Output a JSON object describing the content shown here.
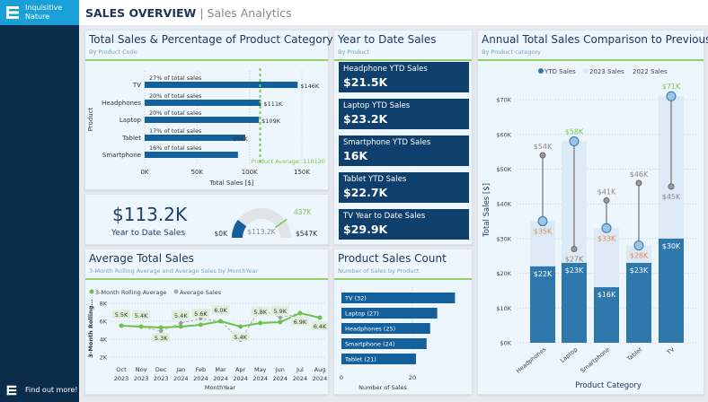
{
  "sidebar": {
    "brand_line1": "Inquisitive",
    "brand_line2": "Nature",
    "find_out_more": "Find out more!"
  },
  "header": {
    "title": "SALES OVERVIEW",
    "separator": "|",
    "subtitle": "Sales Analytics"
  },
  "colors": {
    "navy": "#0b2d4b",
    "brand": "#1aa0d9",
    "bar": "#13609d",
    "accent_green": "#8fd16d",
    "ytd": "#2e78ad",
    "sales2023": "#dde9f5",
    "label_orange": "#e08a5a"
  },
  "panels": {
    "total_sales": {
      "title": "Total Sales & Percentage of Product Category",
      "subtitle": "By Product Code"
    },
    "ytd": {
      "title": "Year to Date Sales",
      "subtitle": "By Product"
    },
    "annual": {
      "title": "Annual Total Sales Comparison to Previous",
      "subtitle": "By Product category"
    },
    "avg": {
      "title": "Average Total Sales",
      "subtitle": "3-Month Rolling Average and Average Sales by MonthYear"
    },
    "count": {
      "title": "Product Sales Count",
      "subtitle": "Number of Sales by Product"
    }
  },
  "kpi": {
    "value": "$113.2K",
    "label": "Year to Date Sales",
    "gauge": {
      "min_label": "$0K",
      "max_label": "$547K",
      "value_label": "$113.2K",
      "target_label": "437K",
      "value": 113.2,
      "min": 0,
      "max": 547,
      "target": 437
    }
  },
  "ytd_cards": [
    {
      "label": "Headphone YTD Sales",
      "value": "$21.5K"
    },
    {
      "label": "Laptop YTD Sales",
      "value": "$23.2K"
    },
    {
      "label": "Smartphone YTD Sales",
      "value": "16K"
    },
    {
      "label": "Tablet YTD Sales",
      "value": "$22.7K"
    },
    {
      "label": "TV Year to Date Sales",
      "value": "$29.9K"
    }
  ],
  "chart_data": [
    {
      "type": "bar",
      "orientation": "horizontal",
      "categories": [
        "TV",
        "Headphones",
        "Laptop",
        "Tablet",
        "Smartphone"
      ],
      "values": [
        146,
        111,
        109,
        96,
        89
      ],
      "value_labels": [
        "$146K",
        "$111K",
        "$109K",
        "$96K",
        ""
      ],
      "percent_labels": [
        "27% of total sales",
        "20% of total sales",
        "20% of total sales",
        "17% of total sales",
        "16% of total sales"
      ],
      "xlabel": "Total Sales [$]",
      "ylabel": "Product",
      "xticks": [
        "0K",
        "50K",
        "100K",
        "150K"
      ],
      "xlim": [
        0,
        150
      ],
      "reference_line": {
        "value": 110.12,
        "label": "Product Average: 110120"
      }
    },
    {
      "type": "line",
      "categories": [
        "Oct 2023",
        "Nov 2023",
        "Dec 2023",
        "Jan 2024",
        "Feb 2024",
        "Mar 2024",
        "Apr 2024",
        "May 2024",
        "Jun 2024",
        "Jul 2024",
        "Aug 2024"
      ],
      "series": [
        {
          "name": "3-Month Rolling Average",
          "values": [
            5.5,
            5.4,
            5.3,
            5.4,
            5.6,
            6.0,
            5.4,
            5.8,
            5.9,
            6.9,
            6.4
          ],
          "labels": [
            "5.5K",
            "5.4K",
            "5.3K",
            "5.4K",
            "5.6K",
            "6.0K",
            "5.4K",
            "5.8K",
            "5.9K",
            "6.9K",
            "6.4K"
          ]
        },
        {
          "name": "Average Sales",
          "values": [
            5.5,
            5.4,
            4.9,
            5.8,
            6.3,
            6.0,
            3.9,
            7.4,
            6.4,
            6.9,
            6.4
          ]
        }
      ],
      "xlabel": "MonthYear",
      "ylabel": "3-Month Rolling...",
      "yticks": [
        "2K",
        "4K",
        "6K",
        "8K"
      ],
      "ylim": [
        2,
        8
      ]
    },
    {
      "type": "bar",
      "orientation": "horizontal",
      "categories": [
        "TV (32)",
        "Laptop (27)",
        "Headphones (25)",
        "Smartphone (24)",
        "Tablet (21)"
      ],
      "values": [
        32,
        27,
        25,
        24,
        21
      ],
      "xlabel": "Number of Sales",
      "xticks": [
        "0",
        "20"
      ]
    },
    {
      "type": "bar",
      "categories": [
        "Headphones",
        "Laptop",
        "Smartphone",
        "Tablet",
        "TV"
      ],
      "series": [
        {
          "name": "YTD Sales",
          "values": [
            22,
            23,
            16,
            23,
            30
          ],
          "labels": [
            "$22K",
            "$23K",
            "$16K",
            "$23K",
            "$30K"
          ]
        },
        {
          "name": "2023 Sales",
          "values": [
            35,
            58,
            33,
            28,
            71
          ],
          "labels": [
            "$35K",
            "$58K",
            "$33K",
            "$28K",
            "$71K"
          ]
        },
        {
          "name": "2022 Sales",
          "values": [
            54,
            27,
            41,
            46,
            45
          ],
          "labels": [
            "$54K",
            "$27K",
            "$41K",
            "$46K",
            "$45K"
          ]
        }
      ],
      "xlabel": "Product Category",
      "ylabel": "Total Sales [$]",
      "yticks": [
        "$0K",
        "$10K",
        "$20K",
        "$30K",
        "$40K",
        "$50K",
        "$60K",
        "$70K"
      ],
      "ylim": [
        0,
        70
      ]
    }
  ]
}
